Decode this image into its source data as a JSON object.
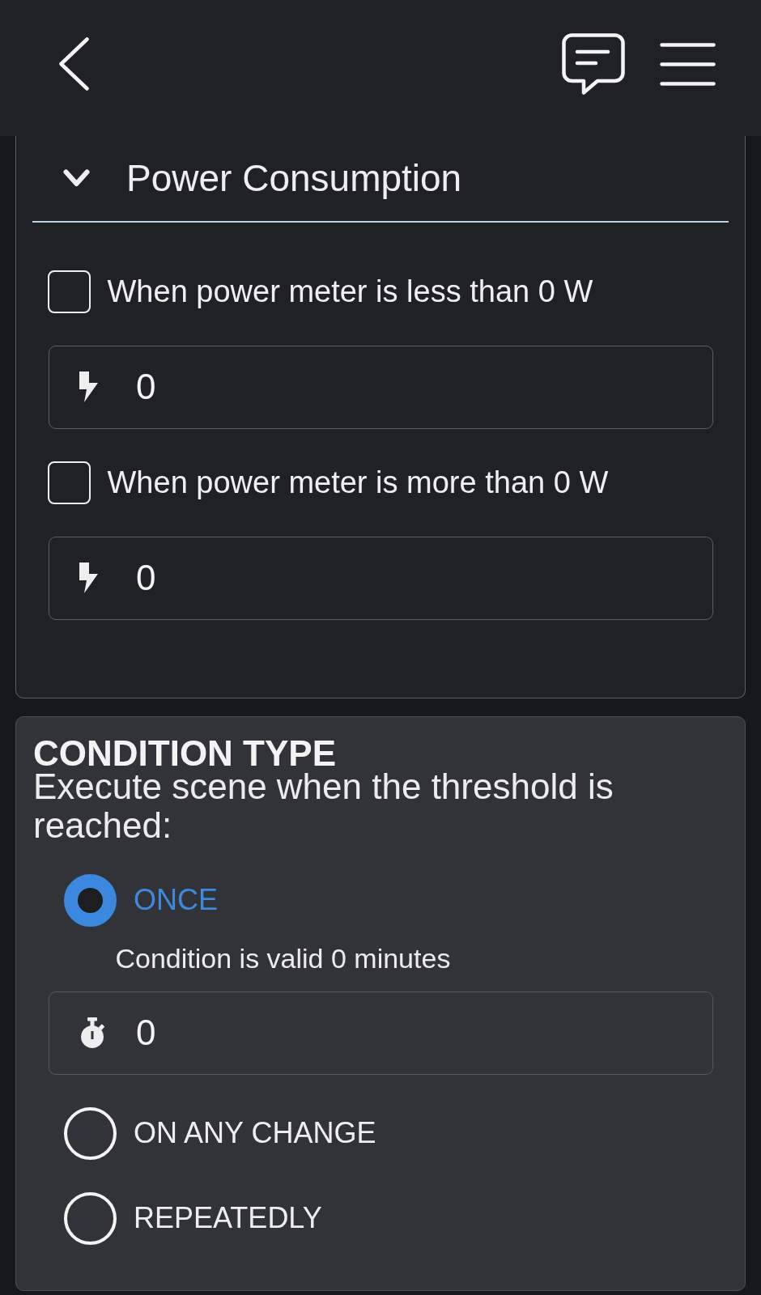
{
  "section": {
    "title": "Power Consumption",
    "expanded": true,
    "conditions": [
      {
        "label": "When power meter is less than 0 W",
        "checked": false,
        "input": {
          "value": "0"
        }
      },
      {
        "label": "When power meter is more than 0 W",
        "checked": false,
        "input": {
          "value": "0"
        }
      }
    ]
  },
  "condition_type": {
    "title": "CONDITION TYPE",
    "description": "Execute scene when the threshold is reached:",
    "options": [
      {
        "label": "ONCE",
        "selected": true,
        "note": "Condition is valid 0 minutes",
        "input": {
          "value": "0"
        }
      },
      {
        "label": "ON ANY CHANGE",
        "selected": false
      },
      {
        "label": "REPEATEDLY",
        "selected": false
      }
    ]
  }
}
